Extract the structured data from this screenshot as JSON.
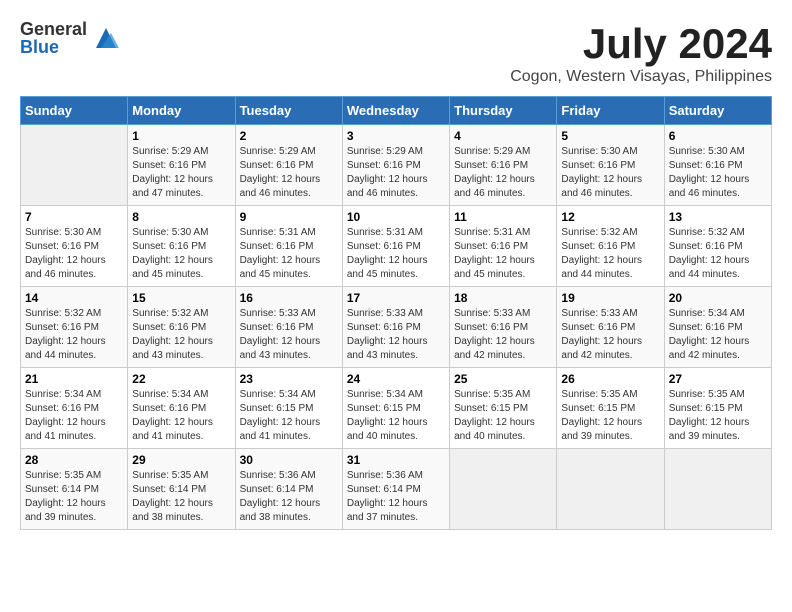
{
  "logo": {
    "general": "General",
    "blue": "Blue"
  },
  "title": "July 2024",
  "subtitle": "Cogon, Western Visayas, Philippines",
  "days_of_week": [
    "Sunday",
    "Monday",
    "Tuesday",
    "Wednesday",
    "Thursday",
    "Friday",
    "Saturday"
  ],
  "weeks": [
    [
      {
        "day": "",
        "info": ""
      },
      {
        "day": "1",
        "info": "Sunrise: 5:29 AM\nSunset: 6:16 PM\nDaylight: 12 hours\nand 47 minutes."
      },
      {
        "day": "2",
        "info": "Sunrise: 5:29 AM\nSunset: 6:16 PM\nDaylight: 12 hours\nand 46 minutes."
      },
      {
        "day": "3",
        "info": "Sunrise: 5:29 AM\nSunset: 6:16 PM\nDaylight: 12 hours\nand 46 minutes."
      },
      {
        "day": "4",
        "info": "Sunrise: 5:29 AM\nSunset: 6:16 PM\nDaylight: 12 hours\nand 46 minutes."
      },
      {
        "day": "5",
        "info": "Sunrise: 5:30 AM\nSunset: 6:16 PM\nDaylight: 12 hours\nand 46 minutes."
      },
      {
        "day": "6",
        "info": "Sunrise: 5:30 AM\nSunset: 6:16 PM\nDaylight: 12 hours\nand 46 minutes."
      }
    ],
    [
      {
        "day": "7",
        "info": "Sunrise: 5:30 AM\nSunset: 6:16 PM\nDaylight: 12 hours\nand 46 minutes."
      },
      {
        "day": "8",
        "info": "Sunrise: 5:30 AM\nSunset: 6:16 PM\nDaylight: 12 hours\nand 45 minutes."
      },
      {
        "day": "9",
        "info": "Sunrise: 5:31 AM\nSunset: 6:16 PM\nDaylight: 12 hours\nand 45 minutes."
      },
      {
        "day": "10",
        "info": "Sunrise: 5:31 AM\nSunset: 6:16 PM\nDaylight: 12 hours\nand 45 minutes."
      },
      {
        "day": "11",
        "info": "Sunrise: 5:31 AM\nSunset: 6:16 PM\nDaylight: 12 hours\nand 45 minutes."
      },
      {
        "day": "12",
        "info": "Sunrise: 5:32 AM\nSunset: 6:16 PM\nDaylight: 12 hours\nand 44 minutes."
      },
      {
        "day": "13",
        "info": "Sunrise: 5:32 AM\nSunset: 6:16 PM\nDaylight: 12 hours\nand 44 minutes."
      }
    ],
    [
      {
        "day": "14",
        "info": "Sunrise: 5:32 AM\nSunset: 6:16 PM\nDaylight: 12 hours\nand 44 minutes."
      },
      {
        "day": "15",
        "info": "Sunrise: 5:32 AM\nSunset: 6:16 PM\nDaylight: 12 hours\nand 43 minutes."
      },
      {
        "day": "16",
        "info": "Sunrise: 5:33 AM\nSunset: 6:16 PM\nDaylight: 12 hours\nand 43 minutes."
      },
      {
        "day": "17",
        "info": "Sunrise: 5:33 AM\nSunset: 6:16 PM\nDaylight: 12 hours\nand 43 minutes."
      },
      {
        "day": "18",
        "info": "Sunrise: 5:33 AM\nSunset: 6:16 PM\nDaylight: 12 hours\nand 42 minutes."
      },
      {
        "day": "19",
        "info": "Sunrise: 5:33 AM\nSunset: 6:16 PM\nDaylight: 12 hours\nand 42 minutes."
      },
      {
        "day": "20",
        "info": "Sunrise: 5:34 AM\nSunset: 6:16 PM\nDaylight: 12 hours\nand 42 minutes."
      }
    ],
    [
      {
        "day": "21",
        "info": "Sunrise: 5:34 AM\nSunset: 6:16 PM\nDaylight: 12 hours\nand 41 minutes."
      },
      {
        "day": "22",
        "info": "Sunrise: 5:34 AM\nSunset: 6:16 PM\nDaylight: 12 hours\nand 41 minutes."
      },
      {
        "day": "23",
        "info": "Sunrise: 5:34 AM\nSunset: 6:15 PM\nDaylight: 12 hours\nand 41 minutes."
      },
      {
        "day": "24",
        "info": "Sunrise: 5:34 AM\nSunset: 6:15 PM\nDaylight: 12 hours\nand 40 minutes."
      },
      {
        "day": "25",
        "info": "Sunrise: 5:35 AM\nSunset: 6:15 PM\nDaylight: 12 hours\nand 40 minutes."
      },
      {
        "day": "26",
        "info": "Sunrise: 5:35 AM\nSunset: 6:15 PM\nDaylight: 12 hours\nand 39 minutes."
      },
      {
        "day": "27",
        "info": "Sunrise: 5:35 AM\nSunset: 6:15 PM\nDaylight: 12 hours\nand 39 minutes."
      }
    ],
    [
      {
        "day": "28",
        "info": "Sunrise: 5:35 AM\nSunset: 6:14 PM\nDaylight: 12 hours\nand 39 minutes."
      },
      {
        "day": "29",
        "info": "Sunrise: 5:35 AM\nSunset: 6:14 PM\nDaylight: 12 hours\nand 38 minutes."
      },
      {
        "day": "30",
        "info": "Sunrise: 5:36 AM\nSunset: 6:14 PM\nDaylight: 12 hours\nand 38 minutes."
      },
      {
        "day": "31",
        "info": "Sunrise: 5:36 AM\nSunset: 6:14 PM\nDaylight: 12 hours\nand 37 minutes."
      },
      {
        "day": "",
        "info": ""
      },
      {
        "day": "",
        "info": ""
      },
      {
        "day": "",
        "info": ""
      }
    ]
  ]
}
